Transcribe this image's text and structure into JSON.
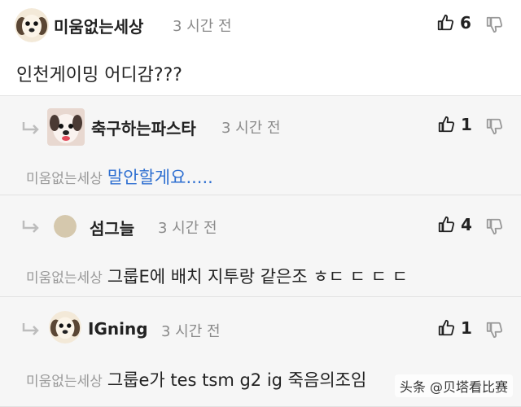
{
  "comments": [
    {
      "username": "미움없는세상",
      "time": "3 시간 전",
      "likes": "6",
      "text": "인천게이밍 어디감???"
    }
  ],
  "replies": [
    {
      "username": "축구하는파스타",
      "time": "3 시간 전",
      "likes": "1",
      "mention": "미움없는세상",
      "text": "말안할게요....."
    },
    {
      "username": "섬그늘",
      "time": "3 시간 전",
      "likes": "4",
      "mention": "미움없는세상",
      "text": "그룹E에 배치 지투랑 같은조 ㅎㄷ ㄷ ㄷ ㄷ"
    },
    {
      "username": "IGning",
      "time": "3 시간 전",
      "likes": "1",
      "mention": "미움없는세상",
      "text": "그룹e가 tes tsm g2 ig 죽음의조임"
    }
  ],
  "watermark": "头条 @贝塔看比赛",
  "icons": {
    "like": "thumbs-up-icon",
    "dislike": "thumbs-down-icon",
    "reply": "reply-arrow-icon"
  },
  "colors": {
    "mention_gray": "#9a9a9a",
    "reply_highlight_blue": "#2e6fd1",
    "reply_background": "#f6f6f6"
  }
}
